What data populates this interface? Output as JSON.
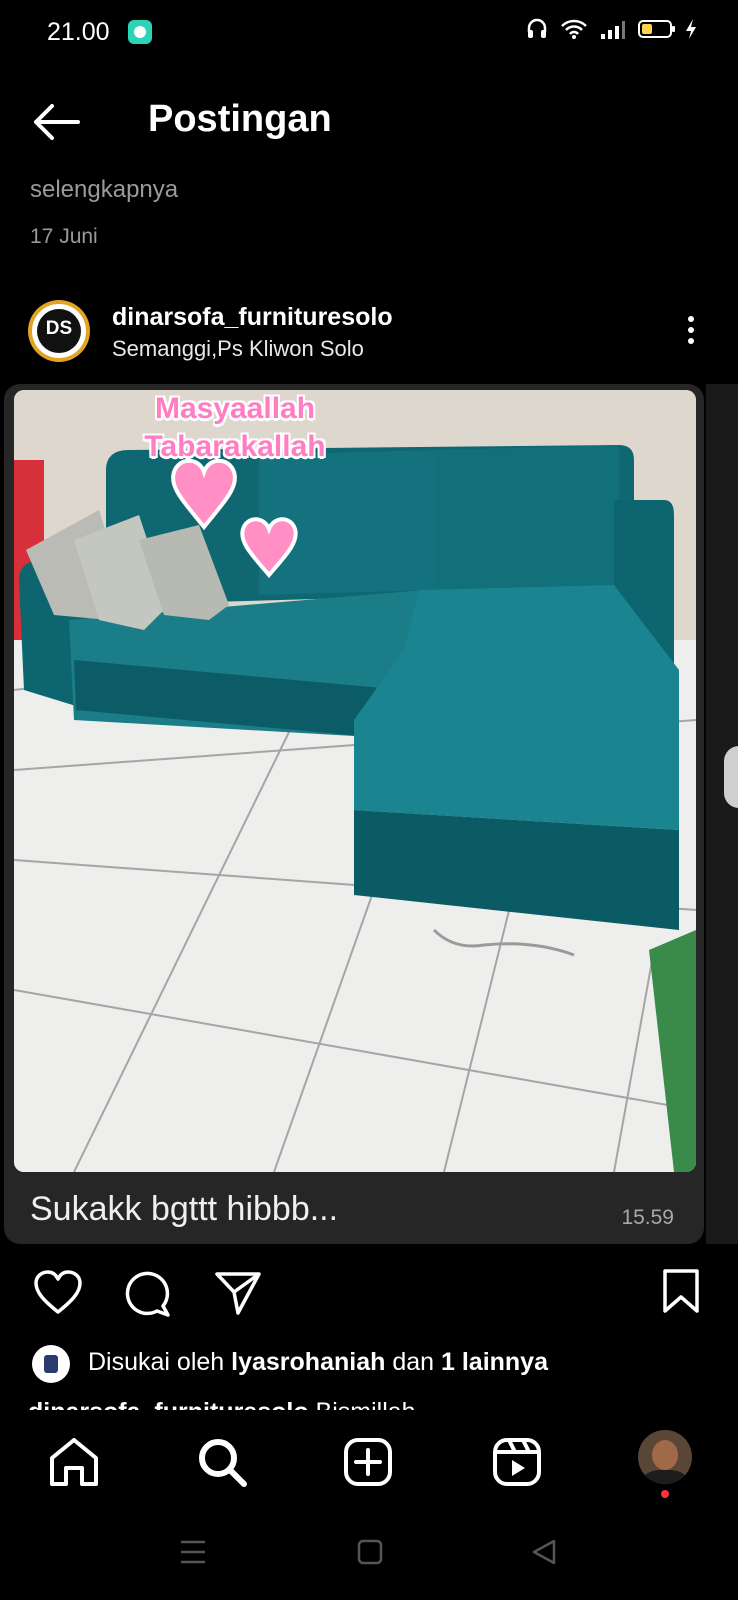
{
  "status_bar": {
    "time": "21.00"
  },
  "header": {
    "title": "Postingan"
  },
  "previous_caption": {
    "more_label": "selengkapnya",
    "date": "17 Juni"
  },
  "post": {
    "username": "dinarsofa_furnituresolo",
    "location": "Semanggi,Ps Kliwon Solo",
    "avatar_initials": "DS",
    "image_overlay_text": [
      "Masyaallah",
      "Tabarakallah"
    ],
    "message": "Sukakk  bgttt hibbb...",
    "time": "15.59"
  },
  "likes": {
    "prefix": "Disukai oleh",
    "user": "lyasrohaniah",
    "middle": "dan",
    "others": "1 lainnya"
  },
  "caption_preview": {
    "username": "dinarsofa_furnituresolo",
    "text": "Bismillah"
  },
  "icons": {
    "back": "arrow-left-icon",
    "more": "more-vertical-icon",
    "like": "heart-icon",
    "comment": "comment-icon",
    "share": "send-icon",
    "save": "bookmark-icon",
    "home": "home-icon",
    "search": "search-icon",
    "create": "plus-square-icon",
    "reels": "reels-icon"
  },
  "colors": {
    "background": "#000000",
    "card": "#262626",
    "sofa": "#14707a",
    "heart": "#ff8fc4",
    "notification": "#ff3040",
    "avatar_ring": "#e3a424"
  }
}
